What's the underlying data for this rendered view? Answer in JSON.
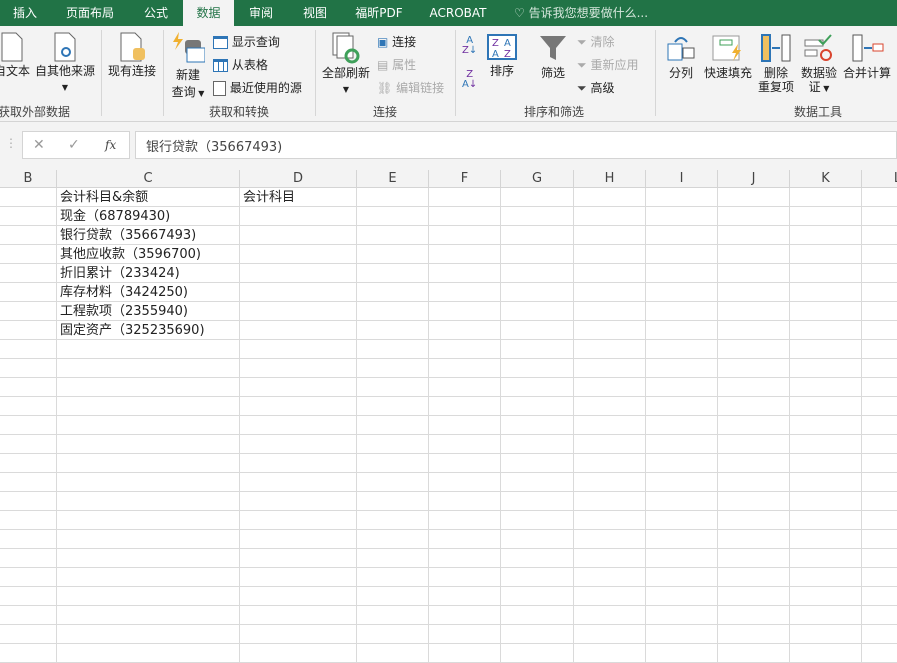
{
  "tabs": [
    "插入",
    "页面布局",
    "公式",
    "数据",
    "审阅",
    "视图",
    "福昕PDF",
    "ACROBAT"
  ],
  "active_tab": "数据",
  "tell_me": "告诉我您想要做什么...",
  "ribbon": {
    "get_external": {
      "from_text": "自文本",
      "from_other": "自其他来源",
      "existing": "现有连接",
      "group": "获取外部数据"
    },
    "get_transform": {
      "new_query": "新建",
      "new_query2": "查询",
      "show_queries": "显示查询",
      "from_table": "从表格",
      "recent_sources": "最近使用的源",
      "group": "获取和转换"
    },
    "connections": {
      "refresh_all": "全部刷新",
      "connections": "连接",
      "properties": "属性",
      "edit_links": "编辑链接",
      "group": "连接"
    },
    "sort_filter": {
      "sort": "排序",
      "filter": "筛选",
      "clear": "清除",
      "reapply": "重新应用",
      "advanced": "高级",
      "group": "排序和筛选"
    },
    "data_tools": {
      "text_to_columns": "分列",
      "flash_fill": "快速填充",
      "remove_dup": "删除",
      "remove_dup2": "重复项",
      "validation": "数据验",
      "validation2": "证",
      "consolidate": "合并计算",
      "group": "数据工具"
    }
  },
  "formula_bar": {
    "value": "银行贷款（35667493)",
    "cancel": "✕",
    "enter": "✓",
    "fx": "fx"
  },
  "columns": [
    "B",
    "C",
    "D",
    "E",
    "F",
    "G",
    "H",
    "I",
    "J",
    "K",
    "L"
  ],
  "cells": {
    "C": [
      "会计科目&余额",
      "现金（68789430)",
      "银行贷款（35667493)",
      "其他应收款（3596700)",
      "折旧累计（233424)",
      "库存材料（3424250)",
      "工程款项（2355940)",
      "固定资产（325235690)"
    ],
    "D": [
      "会计科目"
    ]
  }
}
